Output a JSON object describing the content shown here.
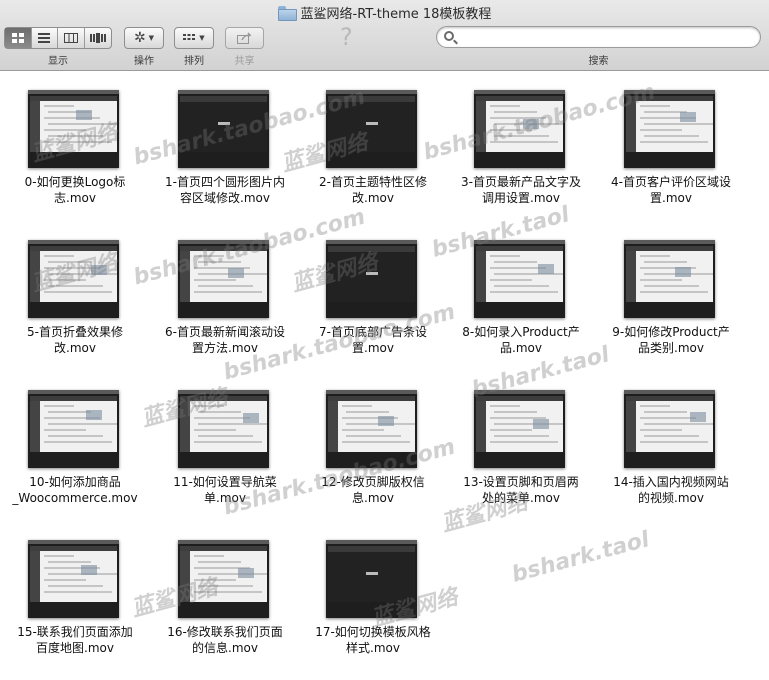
{
  "window": {
    "title": "蓝鲨网络-RT-theme 18模板教程"
  },
  "toolbar": {
    "view_label": "显示",
    "action_label": "操作",
    "arrange_label": "排列",
    "share_label": "共享",
    "help_glyph": "?",
    "search_label": "搜索",
    "search_value": ""
  },
  "files": [
    {
      "line1": "0-如何更换Logo标",
      "line2": "志.mov",
      "style": "light"
    },
    {
      "line1": "1-首页四个圆形图片内",
      "line2": "容区域修改.mov",
      "style": "dark"
    },
    {
      "line1": "2-首页主题特性区修",
      "line2": "改.mov",
      "style": "dark"
    },
    {
      "line1": "3-首页最新产品文字及",
      "line2": "调用设置.mov",
      "style": "light"
    },
    {
      "line1": "4-首页客户评价区域设",
      "line2": "置.mov",
      "style": "light"
    },
    {
      "line1": "5-首页折叠效果修",
      "line2": "改.mov",
      "style": "light"
    },
    {
      "line1": "6-首页最新新闻滚动设",
      "line2": "置方法.mov",
      "style": "light"
    },
    {
      "line1": "7-首页底部广告条设",
      "line2": "置.mov",
      "style": "dark"
    },
    {
      "line1": "8-如何录入Product产",
      "line2": "品.mov",
      "style": "light"
    },
    {
      "line1": "9-如何修改Product产",
      "line2": "品类别.mov",
      "style": "light"
    },
    {
      "line1": "10-如何添加商品",
      "line2": "_Woocommerce.mov",
      "style": "light"
    },
    {
      "line1": "11-如何设置导航菜",
      "line2": "单.mov",
      "style": "light"
    },
    {
      "line1": "12-修改页脚版权信",
      "line2": "息.mov",
      "style": "light"
    },
    {
      "line1": "13-设置页脚和页眉两",
      "line2": "处的菜单.mov",
      "style": "light"
    },
    {
      "line1": "14-插入国内视频网站",
      "line2": "的视频.mov",
      "style": "light"
    },
    {
      "line1": "15-联系我们页面添加",
      "line2": "百度地图.mov",
      "style": "light"
    },
    {
      "line1": "16-修改联系我们页面",
      "line2": "的信息.mov",
      "style": "light"
    },
    {
      "line1": "17-如何切换模板风格",
      "line2": "样式.mov",
      "style": "dark"
    }
  ],
  "watermarks": [
    "bshark.taobao.com",
    "蓝鲨网络",
    "bshark.taol"
  ]
}
